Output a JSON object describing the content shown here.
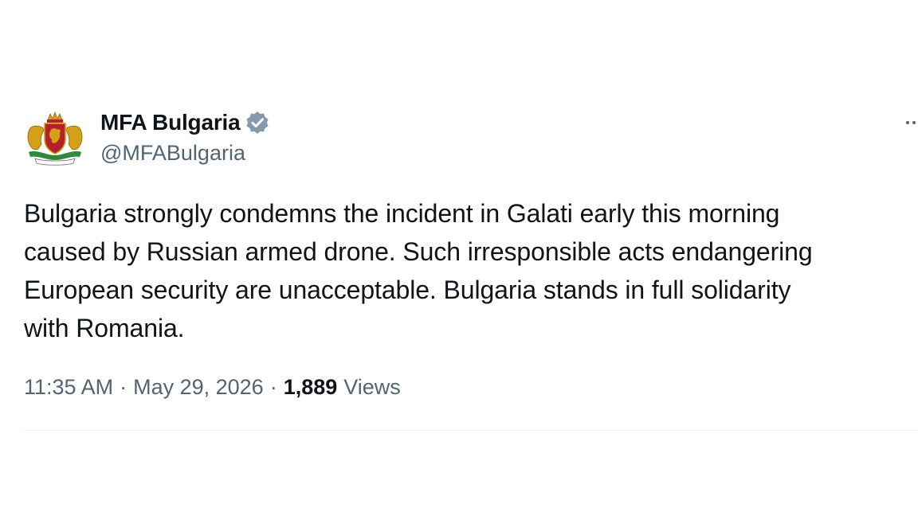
{
  "author": {
    "display_name": "MFA Bulgaria",
    "handle": "@MFABulgaria",
    "avatar_icon": "coat-of-arms-icon",
    "verified_icon": "verified-badge-icon",
    "verified_color": "#829aab"
  },
  "tweet": {
    "lines": [
      "Bulgaria strongly condemns the incident in Galati early this morning",
      "caused by Russian armed drone. Such irresponsible acts endangering",
      "European security are unacceptable. Bulgaria stands in full solidarity",
      "with Romania."
    ]
  },
  "meta": {
    "time": "11:35 AM",
    "separator": "·",
    "date": "May 29, 2026",
    "views_count": "1,889",
    "views_label": "Views"
  },
  "menu": {
    "more_icon": "more-horizontal-icon"
  },
  "colors": {
    "text_primary": "#0f1419",
    "text_secondary": "#536471",
    "divider": "#eff3f4",
    "coat_red": "#b5202a",
    "coat_gold": "#d4a017",
    "coat_green": "#2e8b3e"
  }
}
